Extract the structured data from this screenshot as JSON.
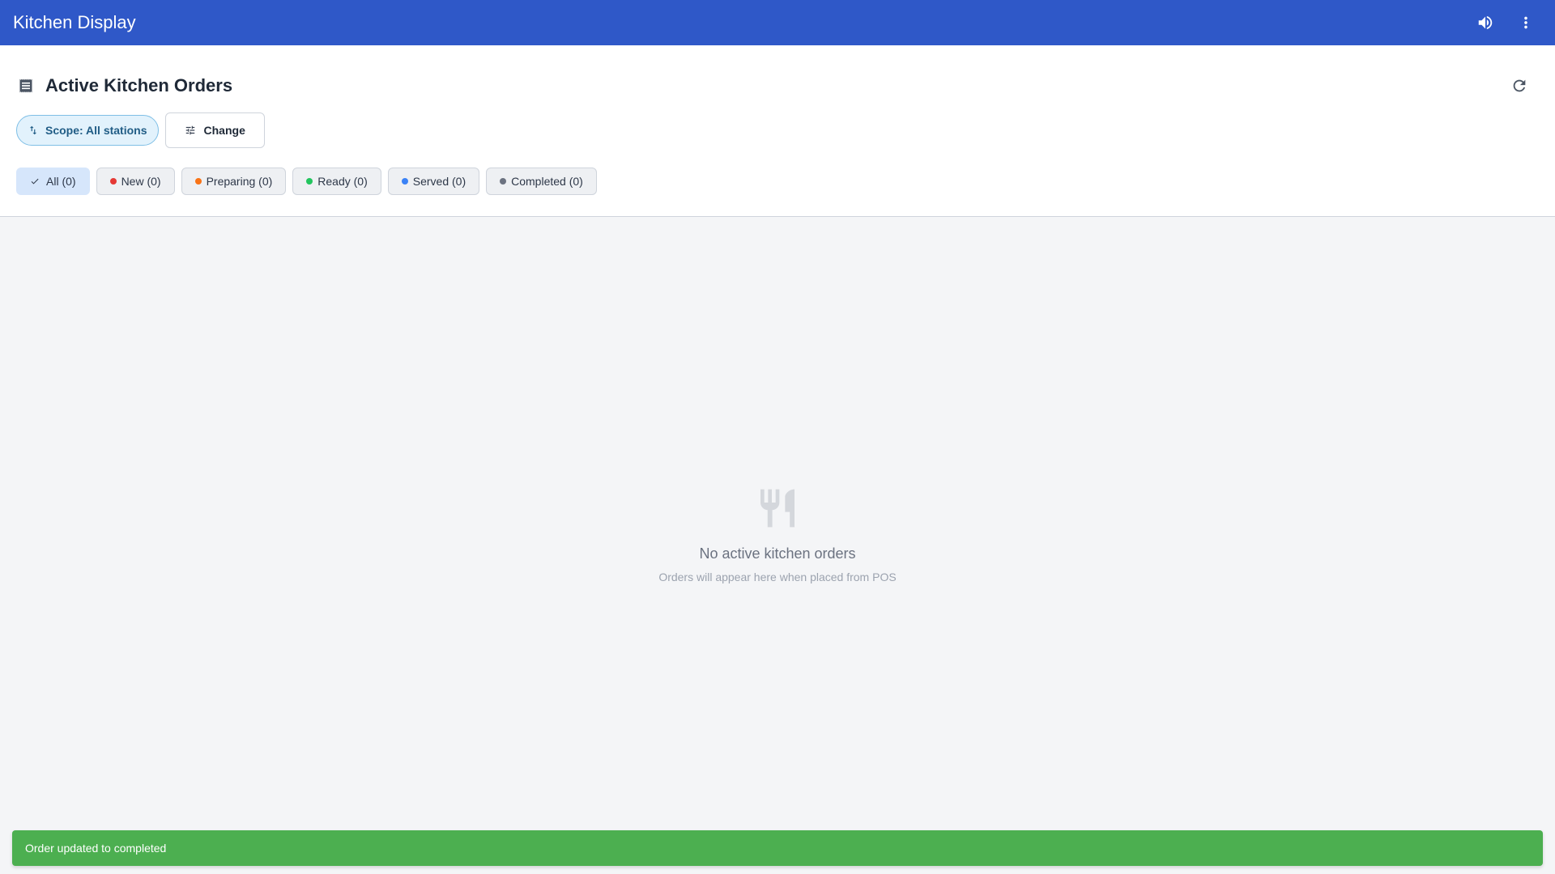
{
  "appbar": {
    "title": "Kitchen Display",
    "actions": [
      {
        "name": "volume-icon"
      },
      {
        "name": "more-vert-icon"
      }
    ],
    "color": "#2f58c8"
  },
  "header": {
    "icon": "receipt-icon",
    "title": "Active Kitchen Orders",
    "refresh_icon": "refresh-icon"
  },
  "scope": {
    "label": "Scope: All stations",
    "icon": "swap-vertical-icon",
    "change_label": "Change",
    "change_icon": "tune-icon"
  },
  "filters": [
    {
      "label": "All (0)",
      "active": true,
      "dot_color": null
    },
    {
      "label": "New (0)",
      "active": false,
      "dot_color": "#e53935"
    },
    {
      "label": "Preparing (0)",
      "active": false,
      "dot_color": "#f97316"
    },
    {
      "label": "Ready (0)",
      "active": false,
      "dot_color": "#22c55e"
    },
    {
      "label": "Served (0)",
      "active": false,
      "dot_color": "#3b82f6"
    },
    {
      "label": "Completed (0)",
      "active": false,
      "dot_color": "#6b7280"
    }
  ],
  "empty_state": {
    "icon": "restaurant-icon",
    "title": "No active kitchen orders",
    "subtitle": "Orders will appear here when placed from POS"
  },
  "snackbar": {
    "message": "Order updated to completed",
    "color": "#4caf50"
  }
}
